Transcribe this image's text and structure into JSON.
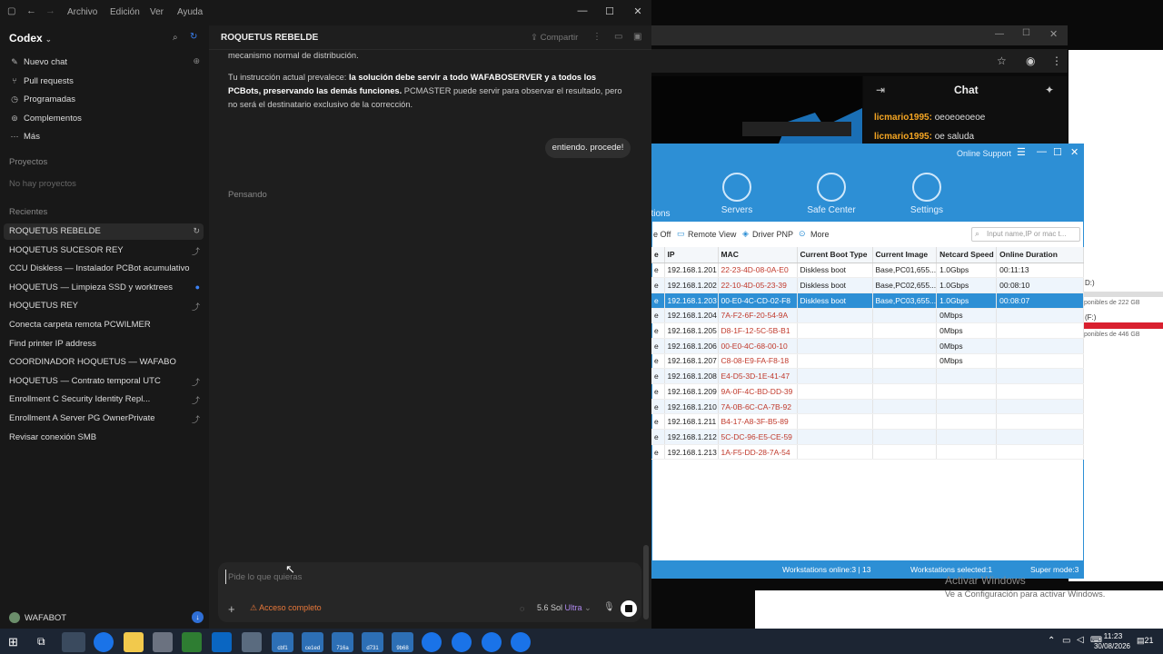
{
  "menubar": {
    "items": [
      "Archivo",
      "Edición",
      "Ver",
      "Ayuda"
    ]
  },
  "sidebar": {
    "app_name": "Codex",
    "nav": [
      {
        "label": "Nuevo chat",
        "icon": "edit-icon"
      },
      {
        "label": "Pull requests",
        "icon": "pull-request-icon"
      },
      {
        "label": "Programadas",
        "icon": "clock-icon"
      },
      {
        "label": "Complementos",
        "icon": "plugin-icon"
      },
      {
        "label": "Más",
        "icon": "more-icon"
      }
    ],
    "projects_title": "Proyectos",
    "no_projects": "No hay proyectos",
    "recents_title": "Recientes",
    "recents": [
      "ROQUETUS REBELDE",
      "HOQUETUS SUCESOR REY",
      "CCU Diskless — Instalador PCBot acumulativo",
      "HOQUETUS — Limpieza SSD y worktrees",
      "HOQUETUS REY",
      "Conecta carpeta remota PCWILMER",
      "Find printer IP address",
      "COORDINADOR HOQUETUS — WAFABO",
      "HOQUETUS — Contrato temporal UTC",
      "Enrollment C Security Identity Repl...",
      "Enrollment A Server PG OwnerPrivate",
      "Revisar conexión SMB"
    ],
    "user": "WAFABOT"
  },
  "chat": {
    "title": "ROQUETUS REBELDE",
    "share": "Compartir",
    "top_text": "mecanismo normal de distribución.",
    "para_prefix": "Tu instrucción actual prevalece: ",
    "para_bold": "la solución debe servir a todo WAFABOSERVER y a todos los PCBots, preservando las demás funciones.",
    "para_suffix": " PCMASTER puede servir para observar el resultado, pero no será el destinatario exclusivo de la corrección.",
    "user_bubble": "entiendo. procede!",
    "thinking": "Pensando",
    "composer_placeholder": "Pide lo que quieras",
    "access": "Acceso completo",
    "model": "5.6 Sol",
    "model_tier": "Ultra"
  },
  "right": {
    "chat_title": "Chat",
    "chat_lines": [
      {
        "user": "licmario1995:",
        "msg": "oeoeoeoeoe"
      },
      {
        "user": "licmario1995:",
        "msg": "oe saluda"
      }
    ],
    "online_support": "Online Support",
    "tabs": [
      "tions",
      "Servers",
      "Safe Center",
      "Settings"
    ],
    "toolbar": [
      "e Off",
      "Remote View",
      "Driver PNP",
      "More"
    ],
    "search_placeholder": "Input name,IP or mac t...",
    "columns": [
      "e",
      "IP",
      "MAC",
      "Current Boot Type",
      "Current Image",
      "Netcard Speed",
      "Online Duration"
    ],
    "rows": [
      [
        "e",
        "192.168.1.201",
        "22-23-4D-08-0A-E0",
        "Diskless boot",
        "Base,PC01,655...",
        "1.0Gbps",
        "00:11:13"
      ],
      [
        "e",
        "192.168.1.202",
        "22-10-4D-05-23-39",
        "Diskless boot",
        "Base,PC02,655...",
        "1.0Gbps",
        "00:08:10"
      ],
      [
        "e",
        "192.168.1.203",
        "00-E0-4C-CD-02-F8",
        "Diskless boot",
        "Base,PC03,655...",
        "1.0Gbps",
        "00:08:07"
      ],
      [
        "e",
        "192.168.1.204",
        "7A-F2-6F-20-54-9A",
        "",
        "",
        "0Mbps",
        ""
      ],
      [
        "e",
        "192.168.1.205",
        "D8-1F-12-5C-5B-B1",
        "",
        "",
        "0Mbps",
        ""
      ],
      [
        "e",
        "192.168.1.206",
        "00-E0-4C-68-00-10",
        "",
        "",
        "0Mbps",
        ""
      ],
      [
        "e",
        "192.168.1.207",
        "C8-08-E9-FA-F8-18",
        "",
        "",
        "0Mbps",
        ""
      ],
      [
        "e",
        "192.168.1.208",
        "E4-D5-3D-1E-41-47",
        "",
        "",
        "",
        ""
      ],
      [
        "e",
        "192.168.1.209",
        "9A-0F-4C-BD-DD-39",
        "",
        "",
        "",
        ""
      ],
      [
        "e",
        "192.168.1.210",
        "7A-0B-6C-CA-7B-92",
        "",
        "",
        "",
        ""
      ],
      [
        "e",
        "192.168.1.211",
        "B4-17-A8-3F-B5-89",
        "",
        "",
        "",
        ""
      ],
      [
        "e",
        "192.168.1.212",
        "5C-DC-96-E5-CE-59",
        "",
        "",
        "",
        ""
      ],
      [
        "e",
        "192.168.1.213",
        "1A-F5-DD-28-7A-54",
        "",
        "",
        "",
        ""
      ]
    ],
    "status_online": "Workstations online:3 | 13",
    "status_selected": "Workstations selected:1",
    "status_super": "Super mode:3",
    "disk1": "D:)",
    "disk1_free": "ponibles de 222 GB",
    "disk2": "(F:)",
    "disk2_free": "ponibles de 446 GB",
    "activate_title": "Activar Windows",
    "activate_sub": "Ve a Configuración para activar Windows."
  },
  "taskbar": {
    "time": "11:23",
    "date": "30/08/2026",
    "notif": "21",
    "apps": [
      "cbf1",
      "ce1ed",
      "716a",
      "d731",
      "9b68"
    ]
  }
}
